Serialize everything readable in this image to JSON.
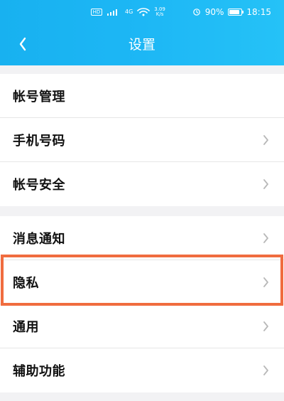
{
  "statusbar": {
    "sim_label": "HD",
    "signal_label": "4G",
    "speed_value": "3.09",
    "speed_unit": "K/s",
    "battery": "90%",
    "time": "18:15"
  },
  "header": {
    "title": "设置"
  },
  "groups": [
    {
      "items": [
        {
          "label": "帐号管理",
          "has_chevron": false
        },
        {
          "label": "手机号码",
          "has_chevron": true
        },
        {
          "label": "帐号安全",
          "has_chevron": true
        }
      ]
    },
    {
      "items": [
        {
          "label": "消息通知",
          "has_chevron": true
        },
        {
          "label": "隐私",
          "has_chevron": true
        },
        {
          "label": "通用",
          "has_chevron": true
        },
        {
          "label": "辅助功能",
          "has_chevron": true
        }
      ]
    }
  ],
  "highlight": {
    "item": "隐私",
    "color": "#f06c3f"
  },
  "colors": {
    "header_start": "#18b1f0",
    "header_end": "#25c2f7",
    "background": "#f2f2f4",
    "text": "#111111",
    "chevron": "#b8b8b8"
  }
}
